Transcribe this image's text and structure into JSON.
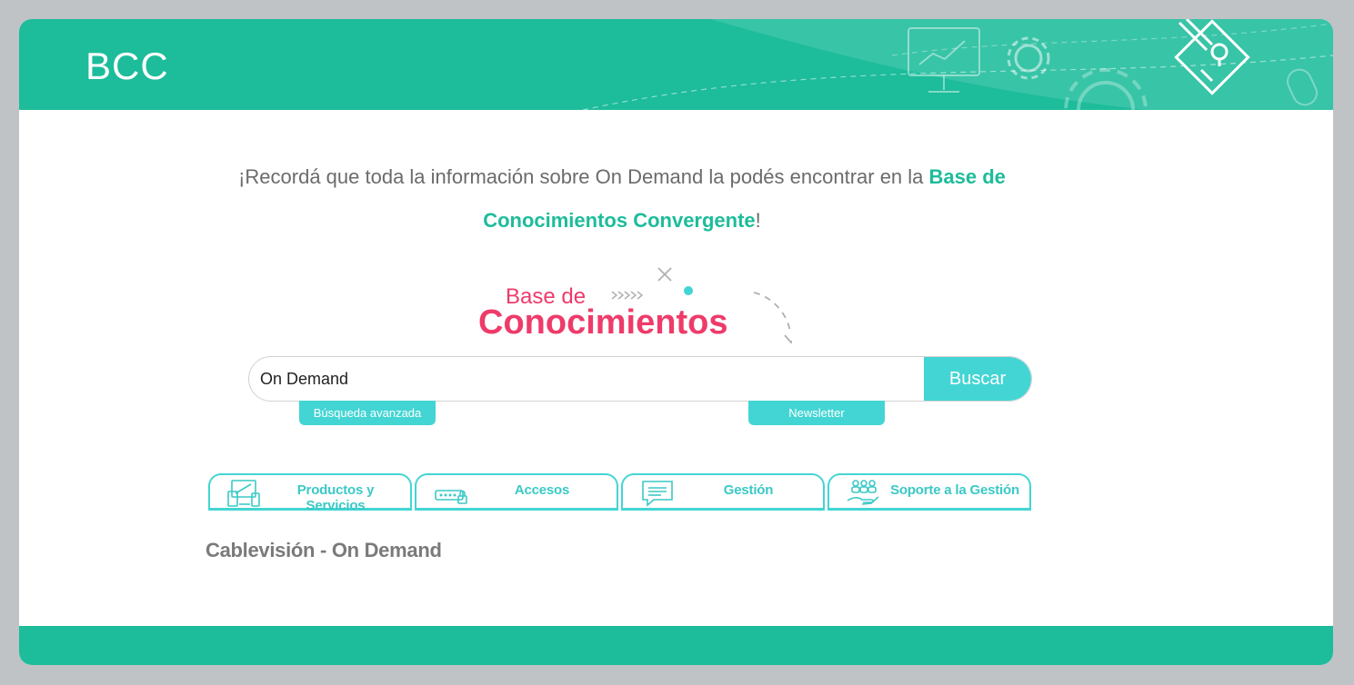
{
  "header": {
    "title": "BCC",
    "brand_color": "#1dbc9b",
    "decor_icons": [
      "presentation-icon",
      "gear-icon",
      "help-document-icon",
      "mouse-icon"
    ]
  },
  "intro": {
    "text_before": "¡Recordá que toda la información sobre On Demand la podés encontrar en la ",
    "highlight_line1": "Base de",
    "highlight_line2": "Conocimientos Convergente",
    "text_after": "!"
  },
  "logo": {
    "line1": "Base de",
    "line2": "Conocimientos",
    "color": "#ee3b6a"
  },
  "search": {
    "value": "On Demand",
    "placeholder": "",
    "button_label": "Buscar",
    "accent": "#43d5d3"
  },
  "links": {
    "advanced": "Búsqueda avanzada",
    "newsletter": "Newsletter"
  },
  "tabs": [
    {
      "label": "Productos y Servicios",
      "icon": "devices-icon"
    },
    {
      "label": "Accesos",
      "icon": "password-lock-icon"
    },
    {
      "label": "Gestión",
      "icon": "chat-bubble-icon"
    },
    {
      "label": "Soporte a la Gestión",
      "icon": "people-hand-icon"
    }
  ],
  "section": {
    "title": "Cablevisión - On Demand"
  }
}
